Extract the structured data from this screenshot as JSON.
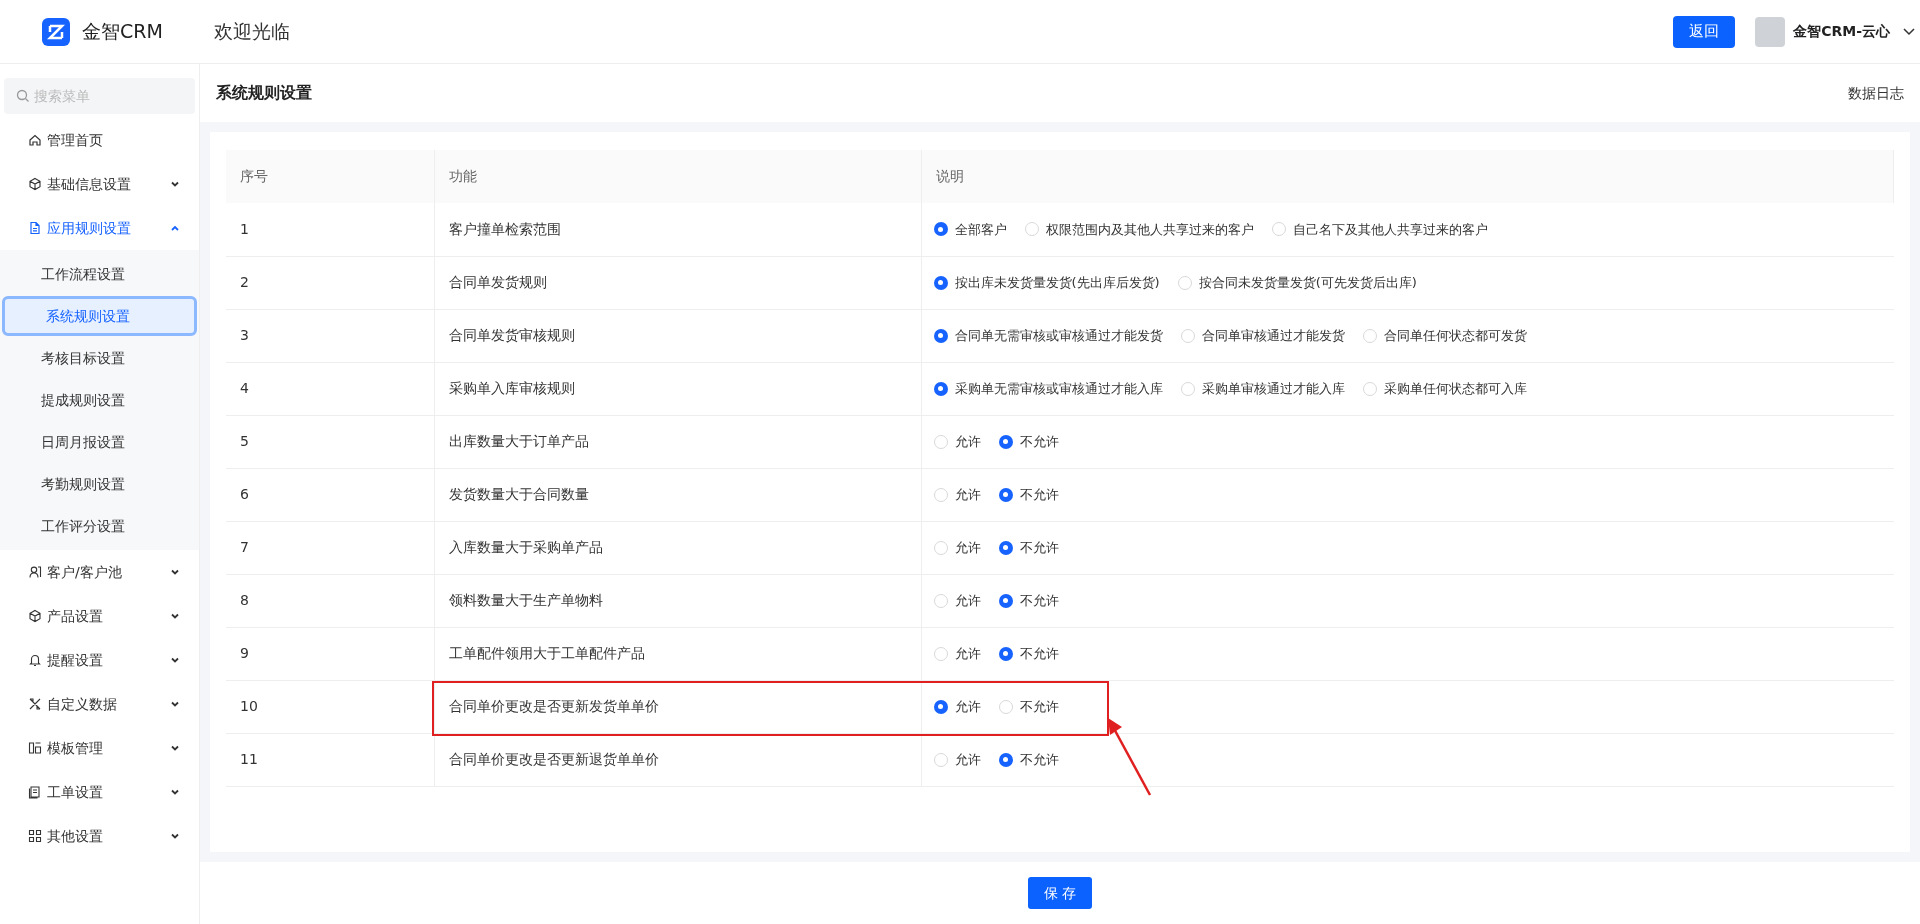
{
  "header": {
    "brand": "金智CRM",
    "welcome": "欢迎光临",
    "back_button": "返回",
    "user": "金智CRM-云心"
  },
  "sidebar": {
    "search": {
      "placeholder": "搜索菜单"
    },
    "items": [
      {
        "label": "管理首页",
        "selected": false
      },
      {
        "label": "基础信息设置",
        "expanded": false,
        "selected": false
      },
      {
        "label": "应用规则设置",
        "expanded": true,
        "selected": true,
        "children": [
          {
            "label": "工作流程设置",
            "selected": false
          },
          {
            "label": "系统规则设置",
            "selected": true
          },
          {
            "label": "考核目标设置",
            "selected": false
          },
          {
            "label": "提成规则设置",
            "selected": false
          },
          {
            "label": "日周月报设置",
            "selected": false
          },
          {
            "label": "考勤规则设置",
            "selected": false
          },
          {
            "label": "工作评分设置",
            "selected": false
          }
        ]
      },
      {
        "label": "客户/客户池",
        "expanded": false,
        "selected": false
      },
      {
        "label": "产品设置",
        "expanded": false,
        "selected": false
      },
      {
        "label": "提醒设置",
        "expanded": false,
        "selected": false
      },
      {
        "label": "自定义数据",
        "expanded": false,
        "selected": false
      },
      {
        "label": "模板管理",
        "expanded": false,
        "selected": false
      },
      {
        "label": "工单设置",
        "expanded": false,
        "selected": false
      },
      {
        "label": "其他设置",
        "expanded": false,
        "selected": false
      }
    ]
  },
  "page": {
    "title": "系统规则设置",
    "log_link": "数据日志"
  },
  "table": {
    "columns": [
      "序号",
      "功能",
      "说明"
    ],
    "rows": [
      {
        "index": "1",
        "feature": "客户撞单检索范围",
        "options": [
          {
            "label": "全部客户",
            "selected": true
          },
          {
            "label": "权限范围内及其他人共享过来的客户",
            "selected": false
          },
          {
            "label": "自己名下及其他人共享过来的客户",
            "selected": false
          }
        ]
      },
      {
        "index": "2",
        "feature": "合同单发货规则",
        "options": [
          {
            "label": "按出库未发货量发货(先出库后发货)",
            "selected": true
          },
          {
            "label": "按合同未发货量发货(可先发货后出库)",
            "selected": false
          }
        ]
      },
      {
        "index": "3",
        "feature": "合同单发货审核规则",
        "options": [
          {
            "label": "合同单无需审核或审核通过才能发货",
            "selected": true
          },
          {
            "label": "合同单审核通过才能发货",
            "selected": false
          },
          {
            "label": "合同单任何状态都可发货",
            "selected": false
          }
        ]
      },
      {
        "index": "4",
        "feature": "采购单入库审核规则",
        "options": [
          {
            "label": "采购单无需审核或审核通过才能入库",
            "selected": true
          },
          {
            "label": "采购单审核通过才能入库",
            "selected": false
          },
          {
            "label": "采购单任何状态都可入库",
            "selected": false
          }
        ]
      },
      {
        "index": "5",
        "feature": "出库数量大于订单产品",
        "options": [
          {
            "label": "允许",
            "selected": false
          },
          {
            "label": "不允许",
            "selected": true
          }
        ]
      },
      {
        "index": "6",
        "feature": "发货数量大于合同数量",
        "options": [
          {
            "label": "允许",
            "selected": false
          },
          {
            "label": "不允许",
            "selected": true
          }
        ]
      },
      {
        "index": "7",
        "feature": "入库数量大于采购单产品",
        "options": [
          {
            "label": "允许",
            "selected": false
          },
          {
            "label": "不允许",
            "selected": true
          }
        ]
      },
      {
        "index": "8",
        "feature": "领料数量大于生产单物料",
        "options": [
          {
            "label": "允许",
            "selected": false
          },
          {
            "label": "不允许",
            "selected": true
          }
        ]
      },
      {
        "index": "9",
        "feature": "工单配件领用大于工单配件产品",
        "options": [
          {
            "label": "允许",
            "selected": false
          },
          {
            "label": "不允许",
            "selected": true
          }
        ]
      },
      {
        "index": "10",
        "feature": "合同单价更改是否更新发货单单价",
        "highlighted": true,
        "options": [
          {
            "label": "允许",
            "selected": true
          },
          {
            "label": "不允许",
            "selected": false
          }
        ]
      },
      {
        "index": "11",
        "feature": "合同单价更改是否更新退货单单价",
        "options": [
          {
            "label": "允许",
            "selected": false
          },
          {
            "label": "不允许",
            "selected": true
          }
        ]
      }
    ]
  },
  "save_button": "保 存"
}
